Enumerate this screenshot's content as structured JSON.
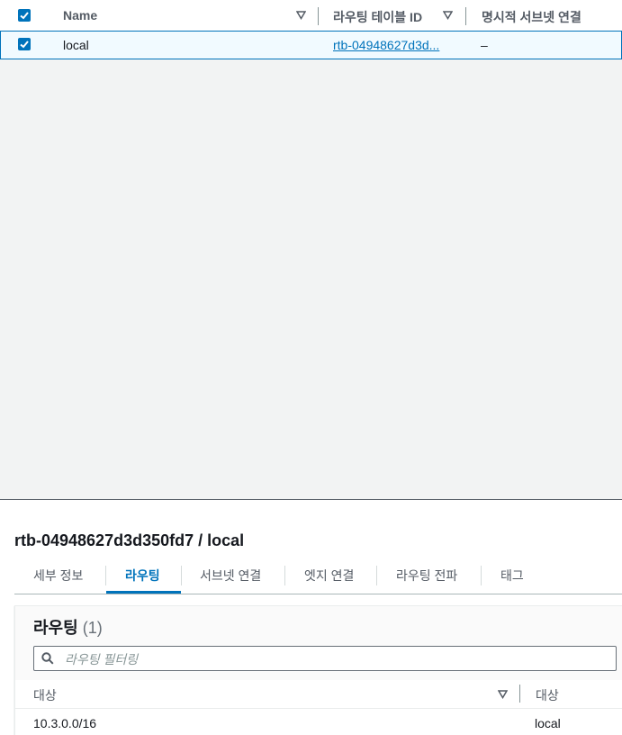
{
  "table": {
    "columns": [
      {
        "label": "Name"
      },
      {
        "label": "라우팅 테이블 ID"
      },
      {
        "label": "명시적 서브넷 연결"
      }
    ],
    "rows": [
      {
        "checked": true,
        "name": "local",
        "route_table_id": "rtb-04948627d3d...",
        "explicit_subnet": "–"
      }
    ]
  },
  "details": {
    "title": "rtb-04948627d3d350fd7 / local",
    "tabs": [
      {
        "label": "세부 정보"
      },
      {
        "label": "라우팅",
        "active": true
      },
      {
        "label": "서브넷 연결"
      },
      {
        "label": "엣지 연결"
      },
      {
        "label": "라우팅 전파"
      },
      {
        "label": "태그"
      }
    ],
    "routes": {
      "title": "라우팅",
      "count": "(1)",
      "filter_placeholder": "라우팅 필터링",
      "columns": [
        "대상",
        "대상"
      ],
      "rows": [
        {
          "destination": "10.3.0.0/16",
          "target": "local"
        }
      ]
    }
  },
  "colors": {
    "accent": "#0073bb",
    "selected_row": "#f1faff",
    "background": "#f2f3f3"
  }
}
